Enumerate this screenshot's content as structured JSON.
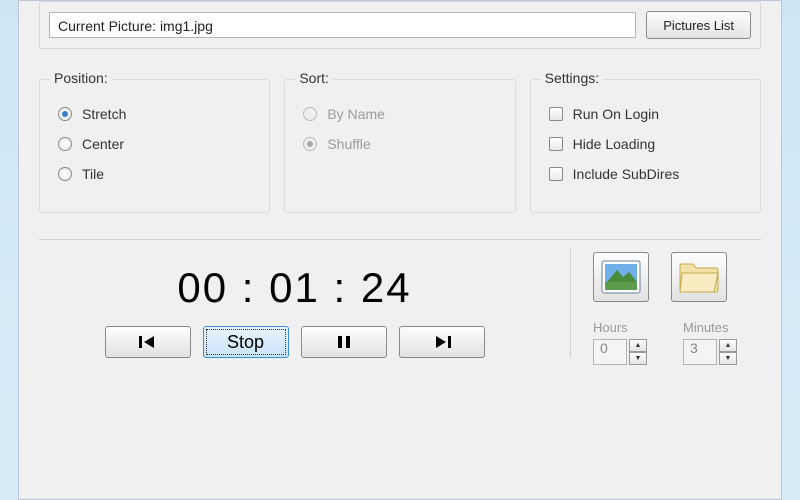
{
  "topbar": {
    "current_label_prefix": "Current Picture: ",
    "current_file": "img1.jpg",
    "pictures_list_btn": "Pictures List"
  },
  "position": {
    "title": "Position:",
    "options": [
      "Stretch",
      "Center",
      "Tile"
    ],
    "selected_index": 0
  },
  "sort": {
    "title": "Sort:",
    "options": [
      "By Name",
      "Shuffle"
    ],
    "selected_index": 1,
    "enabled": false
  },
  "settings": {
    "title": "Settings:",
    "options": [
      "Run On Login",
      "Hide Loading",
      "Include SubDires"
    ],
    "checked": [
      false,
      false,
      false
    ]
  },
  "timer": {
    "display": "00 : 01 : 24"
  },
  "controls": {
    "stop_label": "Stop"
  },
  "interval": {
    "hours_label": "Hours",
    "hours_value": "0",
    "minutes_label": "Minutes",
    "minutes_value": "3",
    "enabled": false
  },
  "icon_buttons": {
    "picture_name": "picture-icon",
    "folder_name": "folder-icon"
  }
}
